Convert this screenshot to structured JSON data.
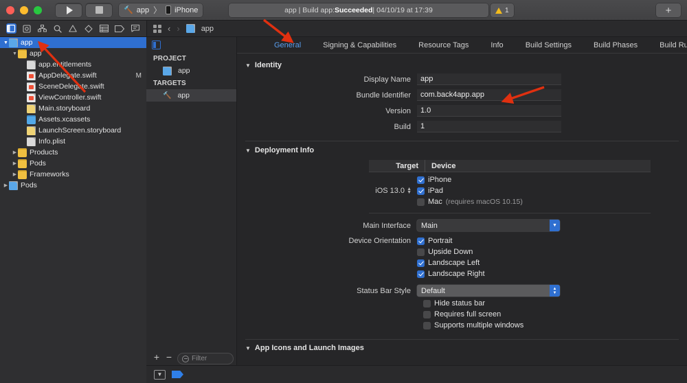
{
  "titlebar": {
    "run_label": "Run",
    "stop_label": "Stop",
    "scheme_name": "app",
    "scheme_separator": "〉",
    "destination": "iPhone",
    "status": {
      "prefix": "app | Build app: ",
      "result": "Succeeded",
      "suffix": " | 04/10/19 at 17:39"
    },
    "warning_count": "1",
    "add_label": "+"
  },
  "navigator_toolbar": {
    "icons": [
      {
        "name": "project-navigator-icon",
        "glyph": "□",
        "selected": true
      },
      {
        "name": "source-control-navigator-icon",
        "glyph": "⊡",
        "selected": false
      },
      {
        "name": "symbol-navigator-icon",
        "glyph": "⛝",
        "selected": false
      },
      {
        "name": "find-navigator-icon",
        "glyph": "⌕",
        "selected": false
      },
      {
        "name": "issue-navigator-icon",
        "glyph": "⚠",
        "selected": false
      },
      {
        "name": "test-navigator-icon",
        "glyph": "◇",
        "selected": false
      },
      {
        "name": "debug-navigator-icon",
        "glyph": "☷",
        "selected": false
      },
      {
        "name": "breakpoint-navigator-icon",
        "glyph": "⬚",
        "selected": false
      },
      {
        "name": "report-navigator-icon",
        "glyph": "☷",
        "selected": false
      }
    ]
  },
  "breadcrumb": {
    "back_glyph": "‹",
    "forward_glyph": "›",
    "path_item": "app"
  },
  "navigator": {
    "items": [
      {
        "label": "app",
        "indent": 0,
        "tri": "▼",
        "icon": "project",
        "selected": true,
        "modified": ""
      },
      {
        "label": "app",
        "indent": 1,
        "tri": "▼",
        "icon": "folder",
        "selected": false,
        "modified": ""
      },
      {
        "label": "app.entitlements",
        "indent": 2,
        "tri": "",
        "icon": "plist",
        "selected": false,
        "modified": ""
      },
      {
        "label": "AppDelegate.swift",
        "indent": 2,
        "tri": "",
        "icon": "swift",
        "selected": false,
        "modified": "M"
      },
      {
        "label": "SceneDelegate.swift",
        "indent": 2,
        "tri": "",
        "icon": "swift",
        "selected": false,
        "modified": ""
      },
      {
        "label": "ViewController.swift",
        "indent": 2,
        "tri": "",
        "icon": "swift",
        "selected": false,
        "modified": ""
      },
      {
        "label": "Main.storyboard",
        "indent": 2,
        "tri": "",
        "icon": "storyboard",
        "selected": false,
        "modified": ""
      },
      {
        "label": "Assets.xcassets",
        "indent": 2,
        "tri": "",
        "icon": "assets",
        "selected": false,
        "modified": ""
      },
      {
        "label": "LaunchScreen.storyboard",
        "indent": 2,
        "tri": "",
        "icon": "storyboard",
        "selected": false,
        "modified": ""
      },
      {
        "label": "Info.plist",
        "indent": 2,
        "tri": "",
        "icon": "plist",
        "selected": false,
        "modified": ""
      },
      {
        "label": "Products",
        "indent": 1,
        "tri": "▶",
        "icon": "folder",
        "selected": false,
        "modified": ""
      },
      {
        "label": "Pods",
        "indent": 1,
        "tri": "▶",
        "icon": "folder",
        "selected": false,
        "modified": ""
      },
      {
        "label": "Frameworks",
        "indent": 1,
        "tri": "▶",
        "icon": "folder",
        "selected": false,
        "modified": ""
      },
      {
        "label": "Pods",
        "indent": 0,
        "tri": "▶",
        "icon": "project",
        "selected": false,
        "modified": ""
      }
    ]
  },
  "project_pane": {
    "project_header": "PROJECT",
    "project_items": [
      {
        "label": "app"
      }
    ],
    "targets_header": "TARGETS",
    "target_items": [
      {
        "label": "app",
        "selected": true
      }
    ],
    "add_label": "+",
    "remove_label": "−",
    "filter_placeholder": "Filter"
  },
  "tabs": [
    {
      "label": "General",
      "active": true
    },
    {
      "label": "Signing & Capabilities",
      "active": false
    },
    {
      "label": "Resource Tags",
      "active": false
    },
    {
      "label": "Info",
      "active": false
    },
    {
      "label": "Build Settings",
      "active": false
    },
    {
      "label": "Build Phases",
      "active": false
    },
    {
      "label": "Build Rules",
      "active": false
    }
  ],
  "identity": {
    "title": "Identity",
    "fields": [
      {
        "label": "Display Name",
        "value": "app"
      },
      {
        "label": "Bundle Identifier",
        "value": "com.back4app.app"
      },
      {
        "label": "Version",
        "value": "1.0"
      },
      {
        "label": "Build",
        "value": "1"
      }
    ]
  },
  "deployment": {
    "title": "Deployment Info",
    "col_target": "Target",
    "col_device": "Device",
    "os_version": "iOS 13.0",
    "devices": [
      {
        "label": "iPhone",
        "checked": true,
        "note": ""
      },
      {
        "label": "iPad",
        "checked": true,
        "note": ""
      },
      {
        "label": "Mac",
        "checked": false,
        "note": "(requires macOS 10.15)"
      }
    ],
    "main_interface_label": "Main Interface",
    "main_interface_value": "Main",
    "orientation_label": "Device Orientation",
    "orientations": [
      {
        "label": "Portrait",
        "checked": true
      },
      {
        "label": "Upside Down",
        "checked": false
      },
      {
        "label": "Landscape Left",
        "checked": true
      },
      {
        "label": "Landscape Right",
        "checked": true
      }
    ],
    "status_bar_label": "Status Bar Style",
    "status_bar_value": "Default",
    "extra_options": [
      {
        "label": "Hide status bar",
        "checked": false
      },
      {
        "label": "Requires full screen",
        "checked": false
      },
      {
        "label": "Supports multiple windows",
        "checked": false
      }
    ]
  },
  "app_icons": {
    "title": "App Icons and Launch Images"
  },
  "colors": {
    "accent": "#2f6fd0",
    "tab_active": "#5a9ff0",
    "warning": "#f3bb1c",
    "annotation": "#e03010",
    "window_bg": "#262628"
  }
}
